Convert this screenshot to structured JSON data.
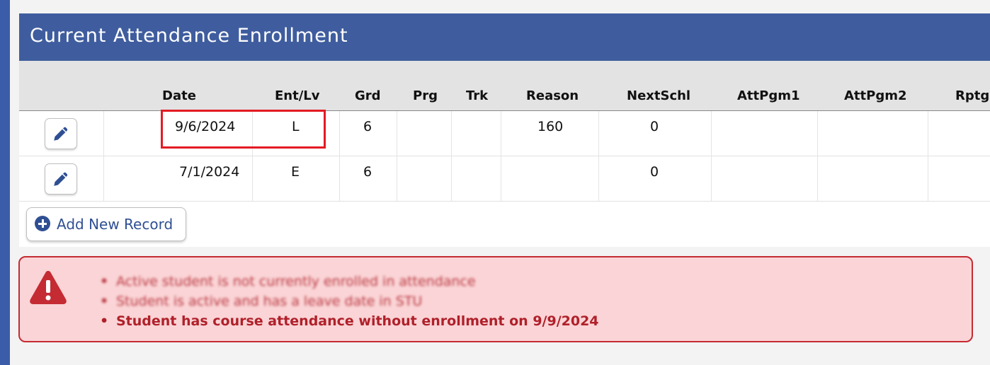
{
  "panel": {
    "title": "Current Attendance Enrollment"
  },
  "columns": [
    "Date",
    "Ent/Lv",
    "Grd",
    "Prg",
    "Trk",
    "Reason",
    "NextSchl",
    "AttPgm1",
    "AttPgm2",
    "RptgS"
  ],
  "rows": [
    {
      "date": "9/6/2024",
      "ent_lv": "L",
      "grd": "6",
      "prg": "",
      "trk": "",
      "reason": "160",
      "nextschl": "0",
      "attpgm1": "",
      "attpgm2": "",
      "rptgs": ""
    },
    {
      "date": "7/1/2024",
      "ent_lv": "E",
      "grd": "6",
      "prg": "",
      "trk": "",
      "reason": "",
      "nextschl": "0",
      "attpgm1": "",
      "attpgm2": "",
      "rptgs": ""
    }
  ],
  "actions": {
    "add_label": "Add New Record"
  },
  "alert": {
    "messages": [
      "Active student is not currently enrolled in attendance",
      "Student is active and has a leave date in STU",
      "Student has course attendance without enrollment on 9/9/2024"
    ]
  },
  "icons": {
    "edit": "pencil-icon",
    "add": "plus-circle-icon",
    "warning": "warning-triangle-icon"
  },
  "colors": {
    "header": "#3f5d9e",
    "accent": "#2f4f93",
    "alert_bg": "#fad4d6",
    "alert_text": "#b0202a",
    "highlight": "#e31b23"
  }
}
